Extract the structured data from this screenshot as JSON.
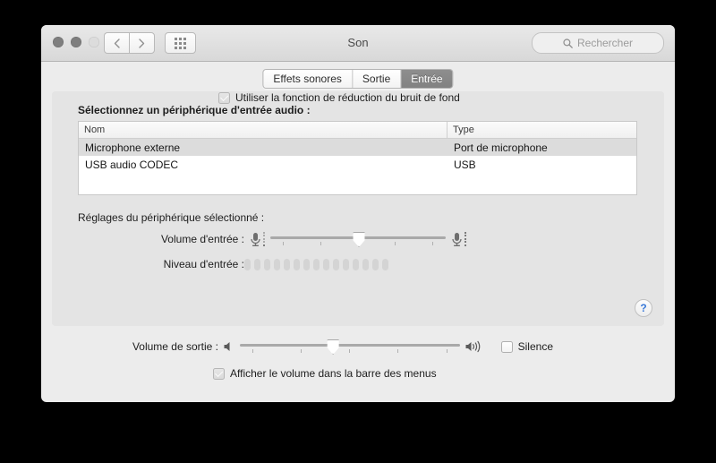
{
  "window": {
    "title": "Son",
    "traffic_lights": [
      "close",
      "minimize",
      "zoom"
    ],
    "nav_back_icon": "chevron-left-icon",
    "nav_forward_icon": "chevron-right-icon",
    "show_all_icon": "grid-icon",
    "search": {
      "placeholder": "Rechercher",
      "value": "",
      "icon": "search-icon"
    }
  },
  "tabs": [
    {
      "label": "Effets sonores",
      "selected": false
    },
    {
      "label": "Sortie",
      "selected": false
    },
    {
      "label": "Entrée",
      "selected": true
    }
  ],
  "device_section": {
    "label": "Sélectionnez un périphérique d'entrée audio :",
    "columns": [
      "Nom",
      "Type"
    ],
    "rows": [
      {
        "name": "Microphone externe",
        "type": "Port de microphone",
        "selected": true
      },
      {
        "name": "USB audio CODEC",
        "type": "USB",
        "selected": false
      }
    ]
  },
  "settings_section": {
    "label": "Réglages du périphérique sélectionné :",
    "input_volume": {
      "label": "Volume d'entrée :",
      "value_percent": 50,
      "tick_count": 5,
      "left_icon": "microphone-low-icon",
      "right_icon": "microphone-high-icon"
    },
    "input_level": {
      "label": "Niveau d'entrée :",
      "segments": 15,
      "lit": 0
    },
    "noise_reduction": {
      "label": "Utiliser la fonction de réduction du bruit de fond",
      "checked": true
    },
    "help_button": {
      "glyph": "?",
      "icon": "help-icon",
      "color": "#3a79d8"
    }
  },
  "output_section": {
    "output_volume": {
      "label": "Volume de sortie :",
      "value_percent": 42,
      "tick_count": 5,
      "left_icon": "speaker-low-icon",
      "right_icon": "speaker-high-icon"
    },
    "mute": {
      "label": "Silence",
      "checked": false
    },
    "show_in_menubar": {
      "label": "Afficher le volume dans la barre des menus",
      "checked": true
    }
  }
}
